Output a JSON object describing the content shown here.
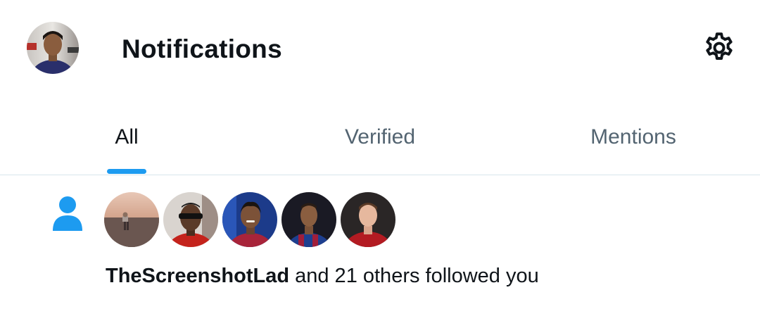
{
  "header": {
    "title": "Notifications",
    "avatar_icon": "profile-avatar",
    "settings_icon": "gear-icon"
  },
  "tabs": [
    {
      "label": "All",
      "active": true
    },
    {
      "label": "Verified",
      "active": false
    },
    {
      "label": "Mentions",
      "active": false
    }
  ],
  "notification": {
    "type_icon": "person-icon",
    "avatars": [
      "follower-avatar-1",
      "follower-avatar-2",
      "follower-avatar-3",
      "follower-avatar-4",
      "follower-avatar-5"
    ],
    "user": "TheScreenshotLad",
    "text": " and 21 others followed you"
  },
  "colors": {
    "accent": "#1d9bf0",
    "text_primary": "#0f1419",
    "text_secondary": "#536471",
    "divider": "#d7e5ec"
  }
}
